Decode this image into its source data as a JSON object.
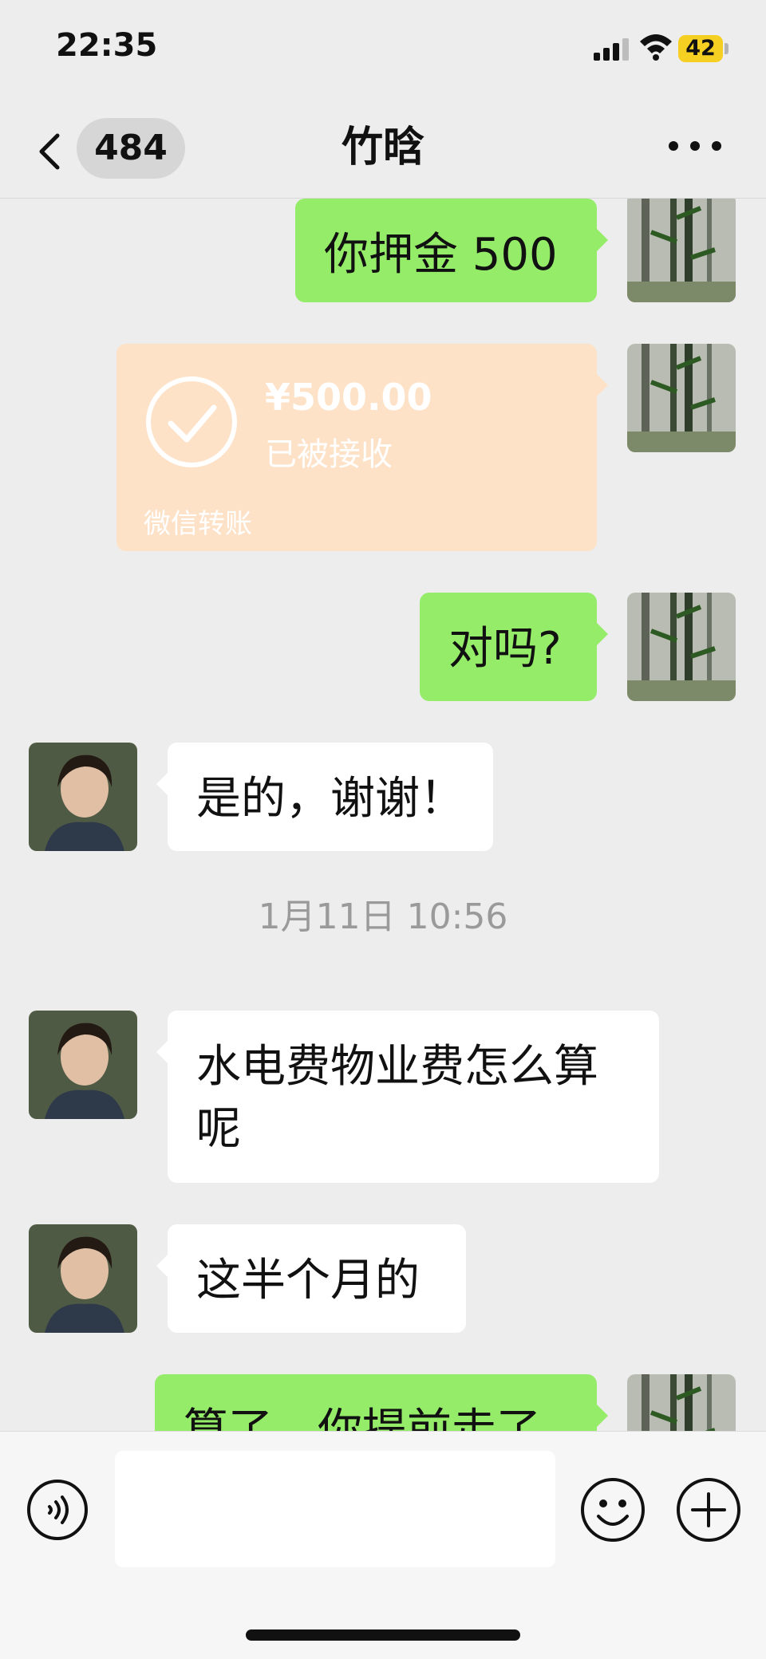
{
  "status_bar": {
    "time": "22:35",
    "battery": "42"
  },
  "nav": {
    "unread_count": "484",
    "title": "竹晗"
  },
  "messages": [
    {
      "side": "mine",
      "text": "你押金 500"
    },
    {
      "side": "mine",
      "type": "transfer",
      "amount": "¥500.00",
      "status": "已被接收",
      "label": "微信转账"
    },
    {
      "side": "mine",
      "text": "对吗?"
    },
    {
      "side": "theirs",
      "text": "是的，谢谢！"
    },
    {
      "type": "timestamp",
      "text": "1月11日 10:56"
    },
    {
      "side": "theirs",
      "text": "水电费物业费怎么算呢"
    },
    {
      "side": "theirs",
      "text": "这半个月的"
    },
    {
      "side": "mine",
      "text": "算了，你提前走了"
    }
  ],
  "input": {
    "value": ""
  },
  "colors": {
    "my_bubble": "#95ec69",
    "their_bubble": "#ffffff",
    "transfer_card": "#fde2c8",
    "background": "#ededed"
  }
}
